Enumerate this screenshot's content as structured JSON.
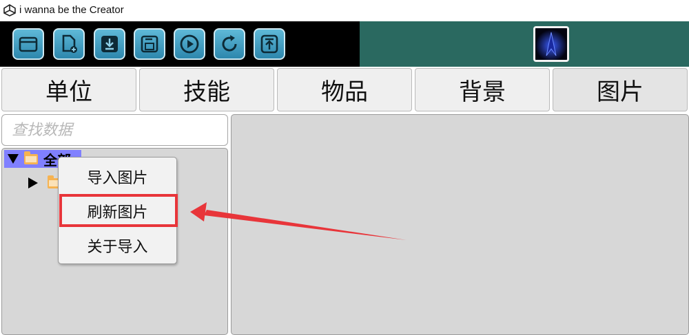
{
  "window": {
    "title": "i wanna be the Creator"
  },
  "toolbar": {
    "buttons": [
      {
        "name": "open-folder-button",
        "icon": "folder-icon"
      },
      {
        "name": "new-file-button",
        "icon": "new-file-icon"
      },
      {
        "name": "download-button",
        "icon": "download-icon"
      },
      {
        "name": "save-button",
        "icon": "save-icon"
      },
      {
        "name": "play-button",
        "icon": "play-icon"
      },
      {
        "name": "refresh-button",
        "icon": "refresh-icon"
      },
      {
        "name": "upload-button",
        "icon": "upload-icon"
      }
    ],
    "color": "#000000",
    "button_color": "#3ea0c7"
  },
  "tabs": [
    {
      "label": "单位"
    },
    {
      "label": "技能"
    },
    {
      "label": "物品"
    },
    {
      "label": "背景"
    },
    {
      "label": "图片"
    }
  ],
  "search": {
    "placeholder": "查找数据",
    "value": ""
  },
  "tree": {
    "root_label": "全部",
    "root_highlight_color": "#8080ff"
  },
  "context_menu": {
    "items": [
      {
        "label": "导入图片"
      },
      {
        "label": "刷新图片"
      },
      {
        "label": "关于导入"
      }
    ],
    "highlight_color": "#e8353a"
  }
}
